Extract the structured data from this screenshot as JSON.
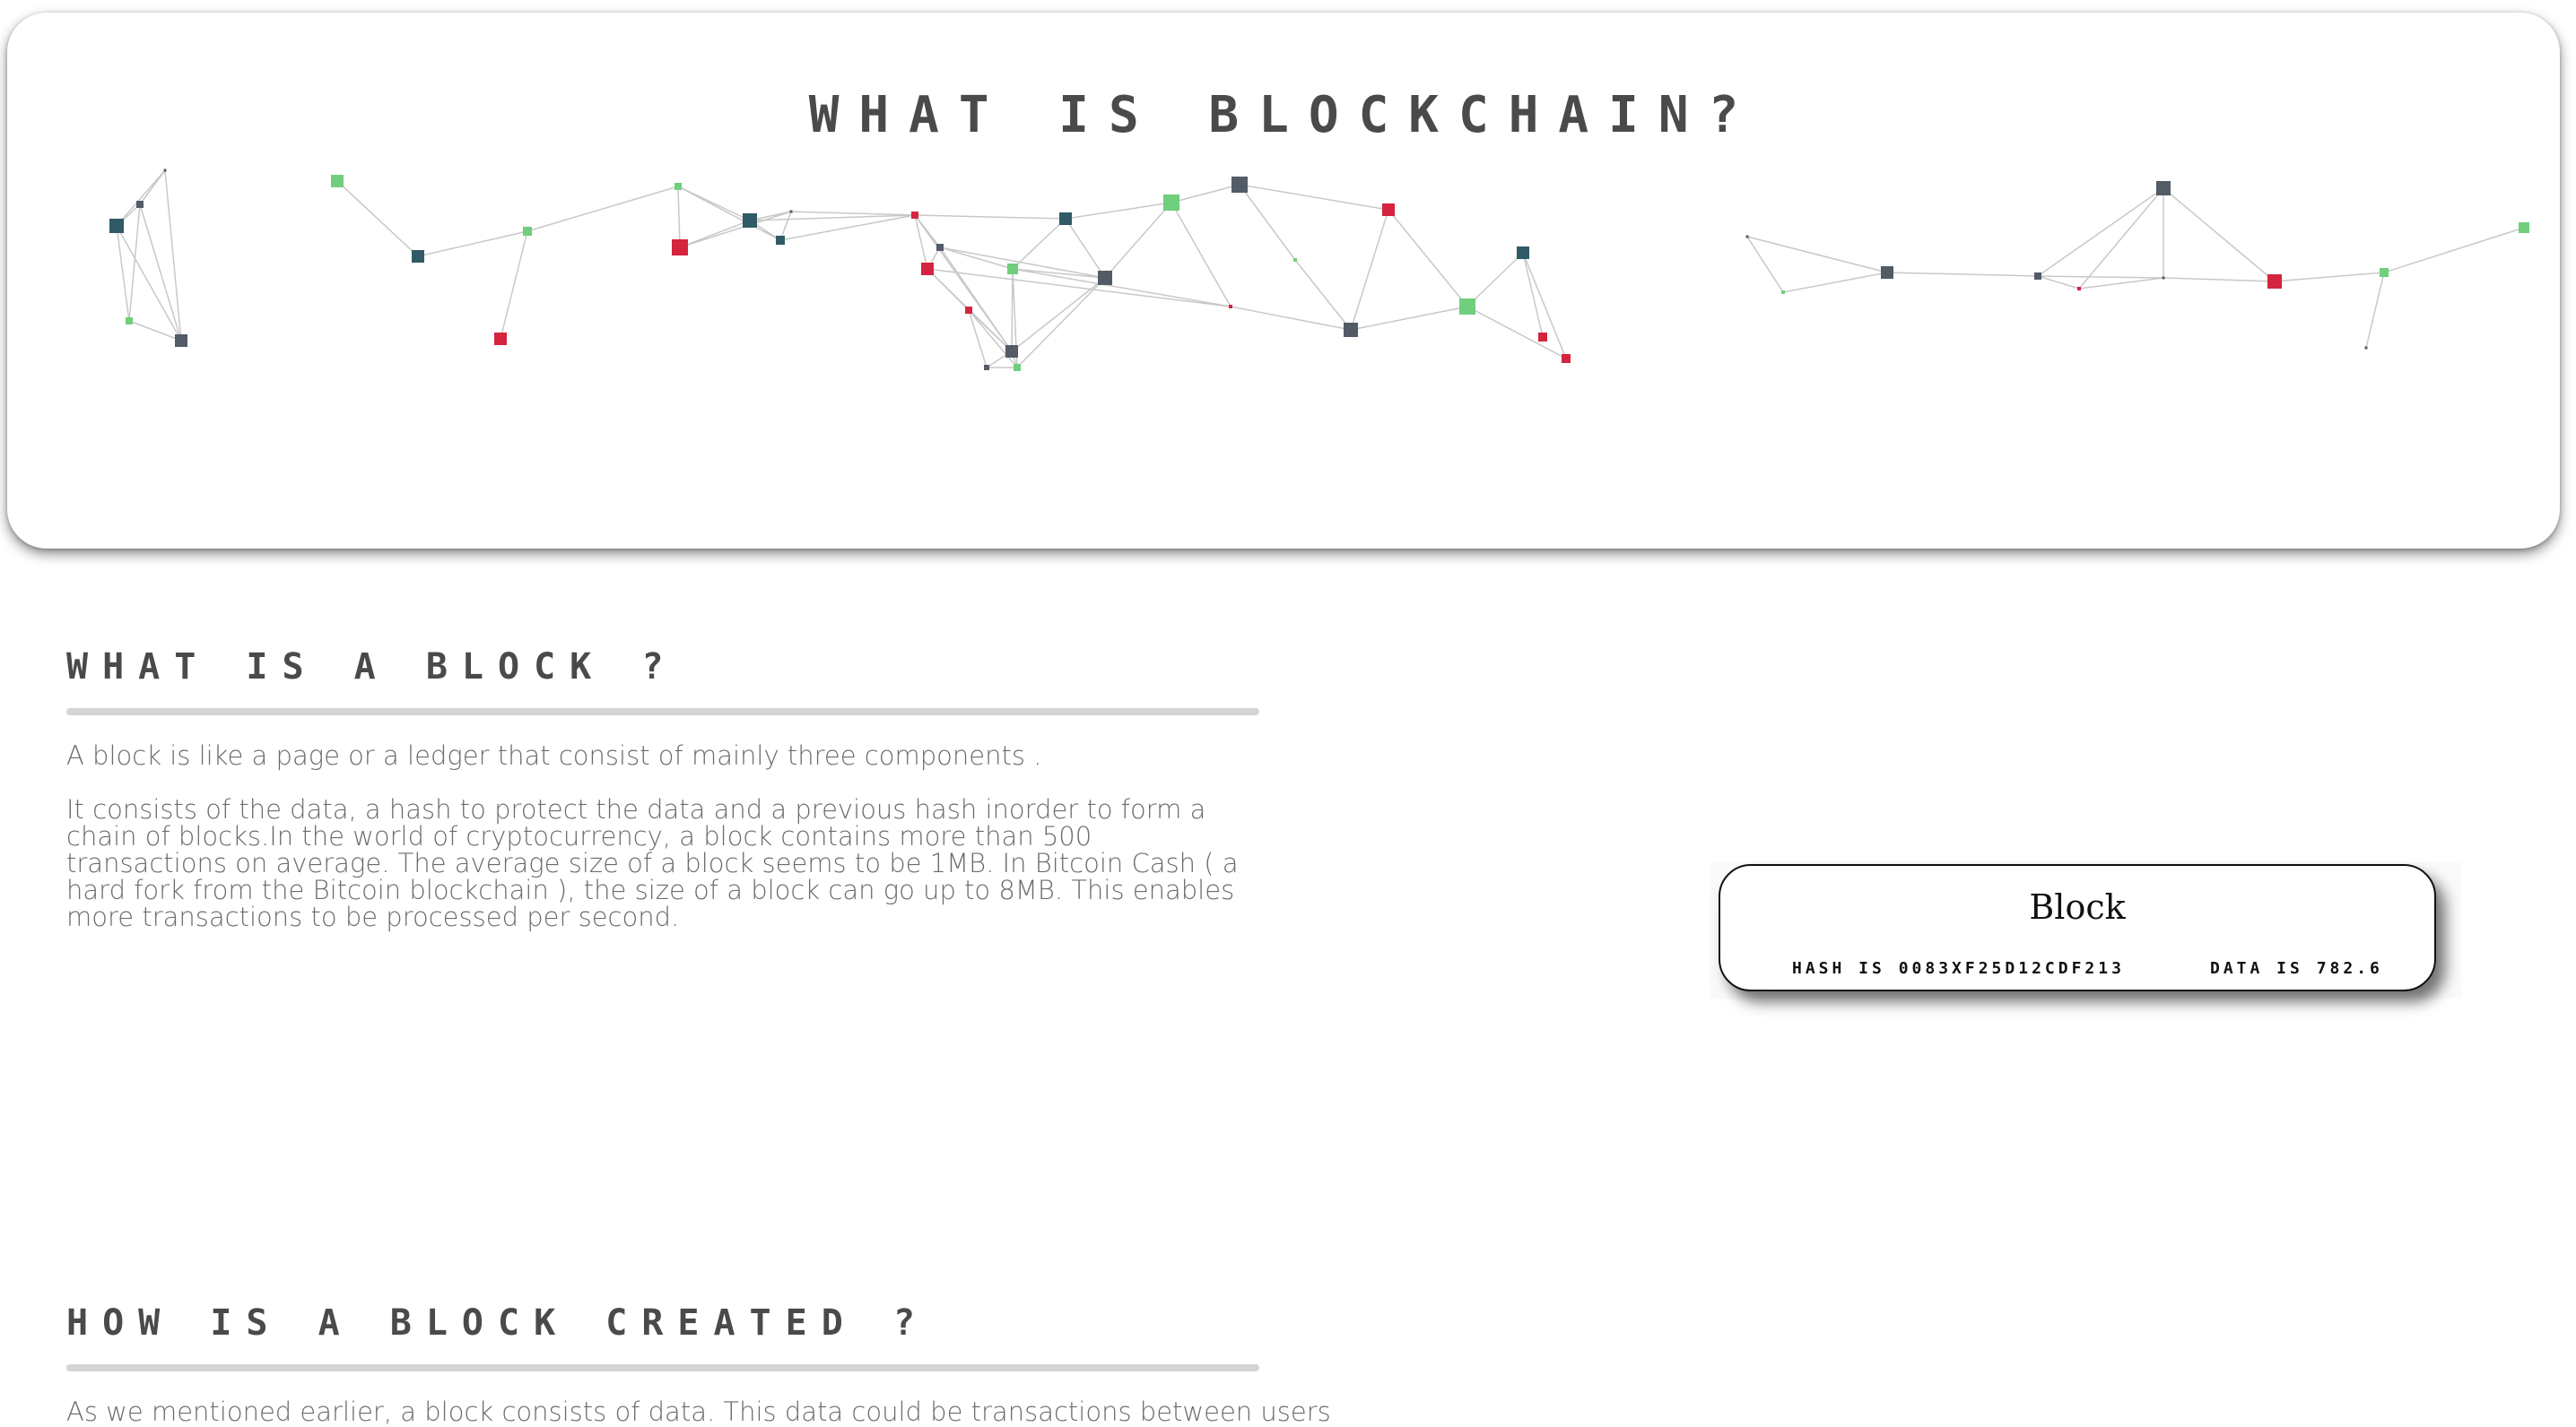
{
  "hero": {
    "title": "WHAT IS BLOCKCHAIN?"
  },
  "network": {
    "colors": {
      "gray": "#525b66",
      "teal": "#2f5a66",
      "red": "#d4243e",
      "green": "#6fcf7c",
      "edge": "#c8c8c8"
    }
  },
  "sections": {
    "block": {
      "heading": "WHAT IS A BLOCK ?",
      "intro": "A block is like a page or a ledger that consist of mainly three components .",
      "body": "It consists of the data, a hash to protect the data and a previous hash inorder to form a chain of blocks.In the world of cryptocurrency, a block contains more than 500 transactions on average. The average size of a block seems to be 1MB. In Bitcoin Cash ( a hard fork from the Bitcoin blockchain ), the size of a block can go up to 8MB. This enables more transactions to be processed per second."
    },
    "created": {
      "heading": "HOW IS A BLOCK CREATED ?",
      "intro": "As we mentioned earlier, a block consists of data. This data could be transactions between users"
    }
  },
  "block_card": {
    "title": "Block",
    "hash": "HASH IS 0083XF25D12CDF213",
    "data": "DATA IS 782.6"
  }
}
